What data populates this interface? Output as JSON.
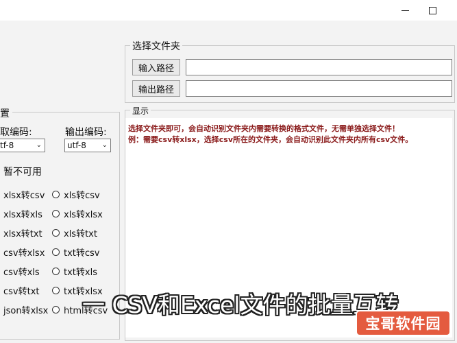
{
  "window": {
    "minimize_icon": "minimize-icon",
    "maximize_icon": "maximize-icon"
  },
  "settings_group": {
    "title": "置",
    "read_encoding_label": "取编码:",
    "output_encoding_label": "输出编码:",
    "read_encoding_value": "tf-8",
    "output_encoding_value": "utf-8",
    "unavailable_label": "暂不可用",
    "radios": [
      [
        "xlsx转csv",
        "xls转csv"
      ],
      [
        "xlsx转xls",
        "xls转xlsx"
      ],
      [
        "xlsx转txt",
        "xls转txt"
      ],
      [
        "csv转xlsx",
        "txt转csv"
      ],
      [
        "csv转xls",
        "txt转xls"
      ],
      [
        "csv转txt",
        "txt转xlsx"
      ],
      [
        "json转xlsx",
        "html转csv"
      ]
    ]
  },
  "folder_group": {
    "title": "选择文件夹",
    "input_path_button": "输入路径",
    "output_path_button": "输出路径",
    "input_path_value": "",
    "output_path_value": ""
  },
  "display_group": {
    "title": "显示",
    "lines": [
      "选择文件夹即可，会自动识别文件夹内需要转换的格式文件，无需单独选择文件！",
      "例：需要csv转xlsx，选择csv所在的文件夹，会自动识别此文件夹内所有csv文件。"
    ]
  },
  "overlay": {
    "caption": "一 CSV和Excel文件的批量互转",
    "watermark": "宝哥软件园"
  }
}
